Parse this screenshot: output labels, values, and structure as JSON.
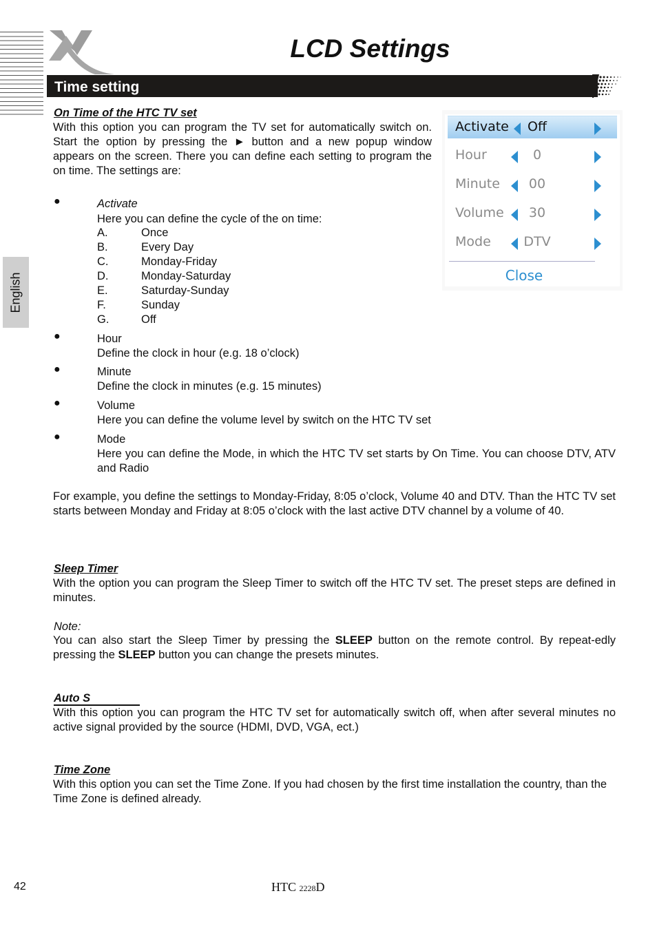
{
  "header": {
    "page_title": "LCD Settings",
    "section_title": "Time setting",
    "language_tab": "English",
    "logo_icon": "x-logo-icon"
  },
  "on_time": {
    "heading": "On Time of the HTC TV set",
    "intro": "With this option you can program the TV set for automatically switch on. Start the option by pressing the ► button and a new popup window appears on the screen. There you can define each setting to program the on time. The settings are:",
    "bullets": [
      {
        "title": "Activate",
        "desc": "Here you can define the cycle of the on time:",
        "options": [
          {
            "letter": "A.",
            "text": "Once"
          },
          {
            "letter": "B.",
            "text": "Every Day"
          },
          {
            "letter": "C.",
            "text": "Monday-Friday"
          },
          {
            "letter": "D.",
            "text": "Monday-Saturday"
          },
          {
            "letter": "E.",
            "text": "Saturday-Sunday"
          },
          {
            "letter": "F.",
            "text": "Sunday"
          },
          {
            "letter": "G.",
            "text": "Off"
          }
        ]
      },
      {
        "title": "Hour",
        "desc": "Define the clock in hour (e.g. 18 o’clock)"
      },
      {
        "title": "Minute",
        "desc": "Define the clock in minutes (e.g. 15 minutes)"
      },
      {
        "title": "Volume",
        "desc": "Here you can define the volume level by switch on the HTC TV set"
      },
      {
        "title": "Mode",
        "desc": "Here you can define the Mode, in which the HTC TV set starts by On Time. You can choose DTV, ATV and Radio"
      }
    ],
    "example": "For example, you define the settings to Monday-Friday, 8:05 o’clock, Volume 40 and DTV. Than the HTC TV set starts between Monday and Friday at 8:05 o’clock with the last active DTV channel by a volume of 40."
  },
  "popup": {
    "rows": [
      {
        "label": "Activate",
        "value": "Off"
      },
      {
        "label": "Hour",
        "value": "0"
      },
      {
        "label": "Minute",
        "value": "00"
      },
      {
        "label": "Volume",
        "value": "30"
      },
      {
        "label": "Mode",
        "value": "DTV"
      }
    ],
    "close_label": "Close",
    "accent_color": "#2d8fd0"
  },
  "sleep_timer": {
    "heading": "Sleep Timer",
    "body": "With the option you can program the Sleep Timer to switch off the HTC TV set. The preset steps are defined in minutes.",
    "note_label": "Note:",
    "note_part1": "You can also start the Sleep Timer by pressing the ",
    "note_bold1": "SLEEP",
    "note_part2": " button on the remote control. By repeat-edly pressing the ",
    "note_bold2": "SLEEP",
    "note_part3": " button you can change the presets minutes."
  },
  "auto_standby": {
    "heading": "Auto S",
    "body": "With this option you can program the HTC TV set for automatically switch off, when after several minutes no active signal provided by the source (HDMI, DVD, VGA, ect.)"
  },
  "time_zone": {
    "heading": "Time Zone",
    "body": "With this option you can set the Time Zone. If you had chosen by the first time installation the country, than the Time Zone is defined already."
  },
  "footer": {
    "page_number": "42",
    "model_prefix": "HTC ",
    "model_num": "2228",
    "model_suffix": "D"
  }
}
